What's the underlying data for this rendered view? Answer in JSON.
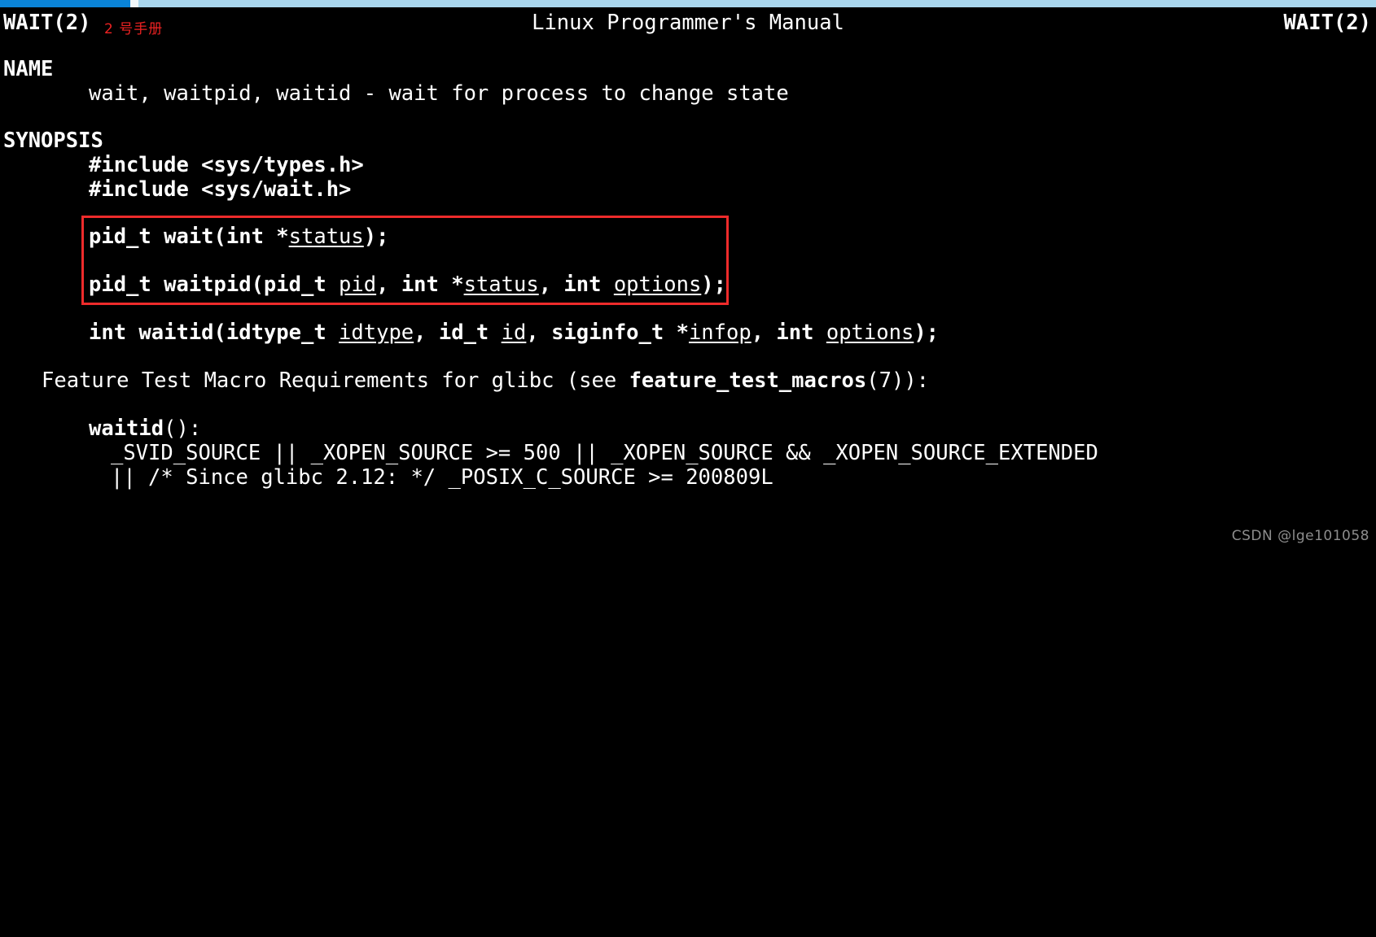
{
  "window": {
    "scrollbar": {
      "filled_color": "#0a84d8",
      "track_color": "#a9d6ed",
      "gap_color": "#f2f7fa"
    }
  },
  "manpage": {
    "header": {
      "left": "WAIT(2)",
      "center": "Linux Programmer's Manual",
      "right": "WAIT(2)",
      "annotation": "2 号手册",
      "annotation_color": "#ee2222"
    },
    "sections": [
      {
        "title": "NAME",
        "lines": [
          "wait, waitpid, waitid - wait for process to change state"
        ]
      },
      {
        "title": "SYNOPSIS",
        "includes": [
          "#include <sys/types.h>",
          "#include <sys/wait.h>"
        ]
      }
    ],
    "prototypes": {
      "wait": {
        "pre": "pid_t wait(int *",
        "arg1": "status",
        "post": ");"
      },
      "waitpid": {
        "p1": "pid_t waitpid(pid_t ",
        "a1": "pid",
        "p2": ", int *",
        "a2": "status",
        "p3": ", int ",
        "a3": "options",
        "p4": ");"
      },
      "waitid": {
        "p1": "int waitid(idtype_t ",
        "a1": "idtype",
        "p2": ", id_t ",
        "a2": "id",
        "p3": ", siginfo_t *",
        "a3": "infop",
        "p4": ", int ",
        "a4": "options",
        "p5": ");"
      }
    },
    "feature_test": {
      "lead": "Feature Test Macro Requirements for glibc (see ",
      "ref": "feature_test_macros",
      "tail": "(7)):",
      "func_name": "waitid",
      "func_suffix": "():",
      "macro_line_1": "_SVID_SOURCE || _XOPEN_SOURCE >= 500 || _XOPEN_SOURCE && _XOPEN_SOURCE_EXTENDED",
      "macro_line_2": "|| /* Since glibc 2.12: */ _POSIX_C_SOURCE >= 200809L"
    },
    "highlight_box": {
      "color": "#ee2b2b"
    }
  },
  "watermark": {
    "text": "CSDN @lge101058"
  }
}
